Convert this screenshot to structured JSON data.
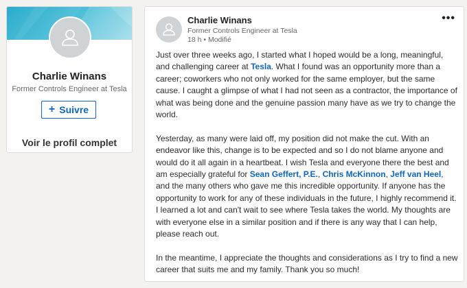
{
  "profile": {
    "name": "Charlie Winans",
    "headline": "Former Controls Engineer at Tesla",
    "follow_label": "Suivre",
    "view_profile_label": "Voir le profil complet",
    "avatar_icon": "person-icon"
  },
  "post": {
    "author": "Charlie Winans",
    "headline": "Former Controls Engineer at Tesla",
    "meta": "18 h • Modifié",
    "menu_icon": "more-icon",
    "paragraph1": {
      "a": "Just over three weeks ago, I started what I hoped would be a long, meaningful, and challenging career at ",
      "mention_tesla": "Tesla",
      "b": ". What I found was an opportunity more than a career; coworkers who not only worked for the same employer, but the same cause. I caught a glimpse of what I had not seen as a contractor, the importance of what was being done and the genuine passion many have as we try to change the world."
    },
    "paragraph2": {
      "a": "Yesterday, as many were laid off, my position did not make the cut.  With an endeavor like this, change is to be expected and so I do not blame anyone and would do it all again in a heartbeat. I wish Tesla and everyone there the best and am especially grateful for ",
      "mention1": "Sean Geffert, P.E.",
      "sep1": ", ",
      "mention2": "Chris McKinnon",
      "sep2": ", ",
      "mention3": "Jeff van Heel",
      "b": ", and the many others who gave me this incredible opportunity. If anyone has the opportunity to work for any of these individuals in the future, I highly recommend it. I learned a lot and can't wait to see where Tesla takes the world. My thoughts are with everyone else in a similar position and if there is any way that I can help, please reach out."
    },
    "paragraph3": "In the meantime, I appreciate the thoughts and considerations as I try to find a new career that suits me and my family. Thank you so much!"
  },
  "colors": {
    "accent": "#0a66c2",
    "banner": "#1aa5c9",
    "background": "#f3f2ef"
  }
}
